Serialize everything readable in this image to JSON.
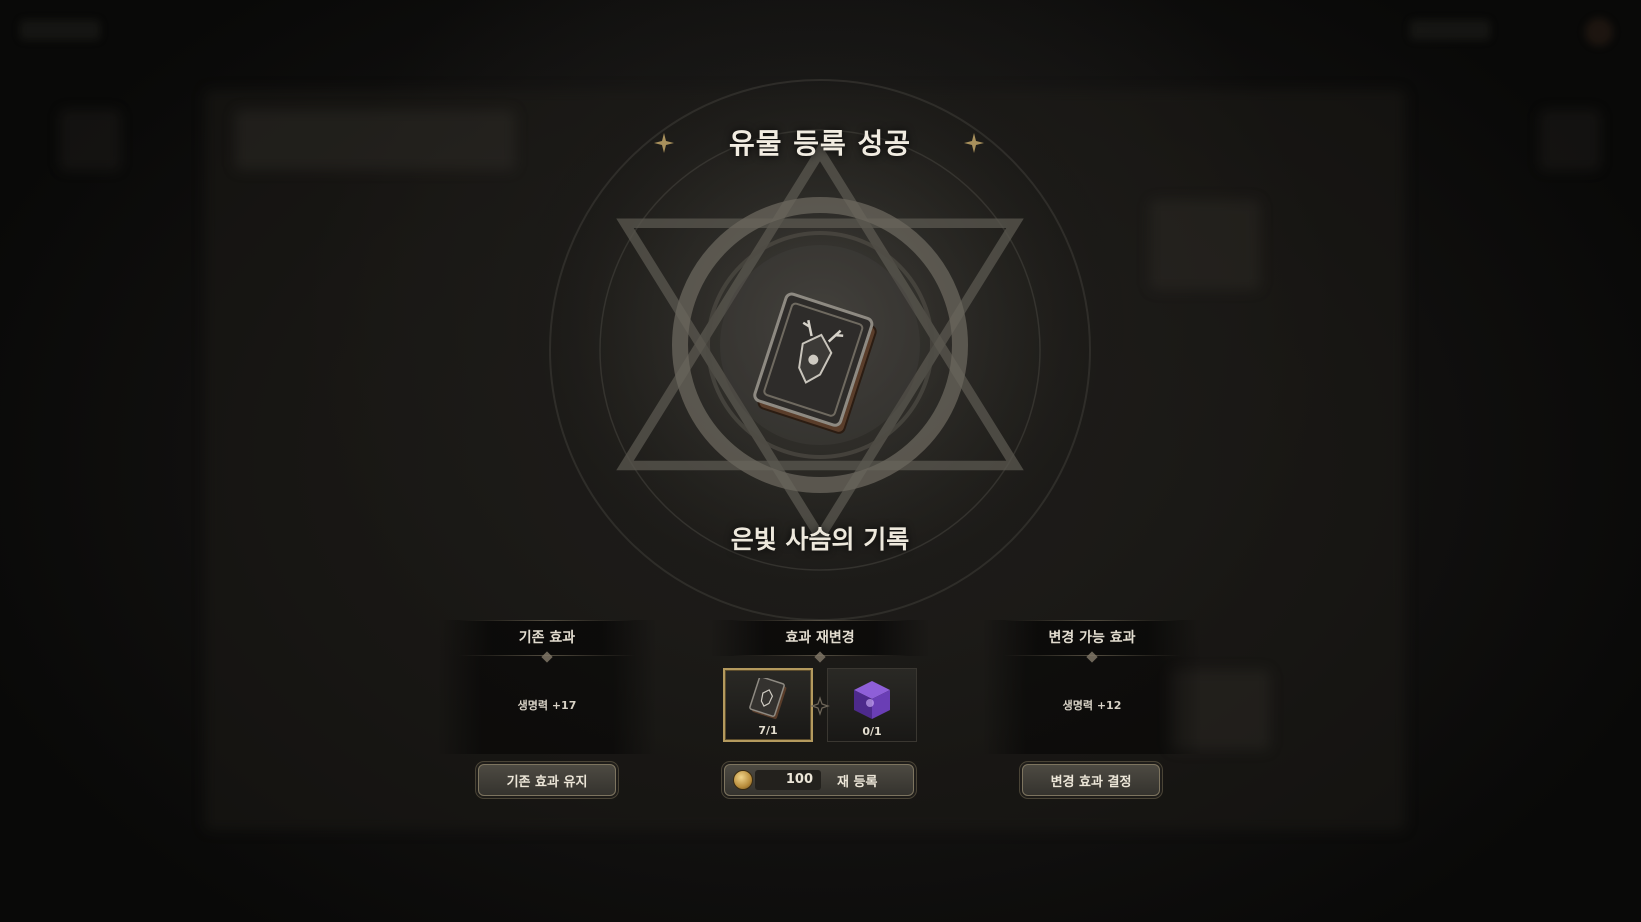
{
  "modal": {
    "title": "유물 등록 성공",
    "item_name": "은빛 사슴의 기록"
  },
  "columns": {
    "current": {
      "header": "기존 효과",
      "effect": "생명력 +17",
      "button": "기존 효과 유지"
    },
    "reroll": {
      "header": "효과 재변경",
      "slots": [
        {
          "icon": "book-icon",
          "count": "7/1"
        },
        {
          "icon": "purple-cube-icon",
          "count": "0/1"
        }
      ],
      "cost": "100",
      "button": "재 등록"
    },
    "new": {
      "header": "변경 가능 효과",
      "effect": "생명력 +12",
      "button": "변경 효과 결정"
    }
  },
  "colors": {
    "accent_gold": "#b49a5e",
    "text": "#e9e4d8",
    "background": "#0b0b0a"
  }
}
